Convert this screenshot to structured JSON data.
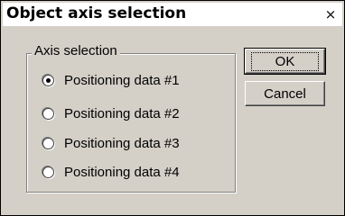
{
  "dialog": {
    "title": "Object axis selection",
    "close_glyph": "×"
  },
  "axis_selection": {
    "group_label": "Axis selection",
    "selected_index": 0,
    "options": [
      {
        "label": "Positioning data #1",
        "checked": true
      },
      {
        "label": "Positioning data #2",
        "checked": false
      },
      {
        "label": "Positioning data #3",
        "checked": false
      },
      {
        "label": "Positioning data #4",
        "checked": false
      }
    ]
  },
  "buttons": {
    "ok_label": "OK",
    "cancel_label": "Cancel"
  },
  "colors": {
    "dialog_face": "#d4d0c8",
    "titlebar": "#ffffff",
    "text": "#000000"
  }
}
